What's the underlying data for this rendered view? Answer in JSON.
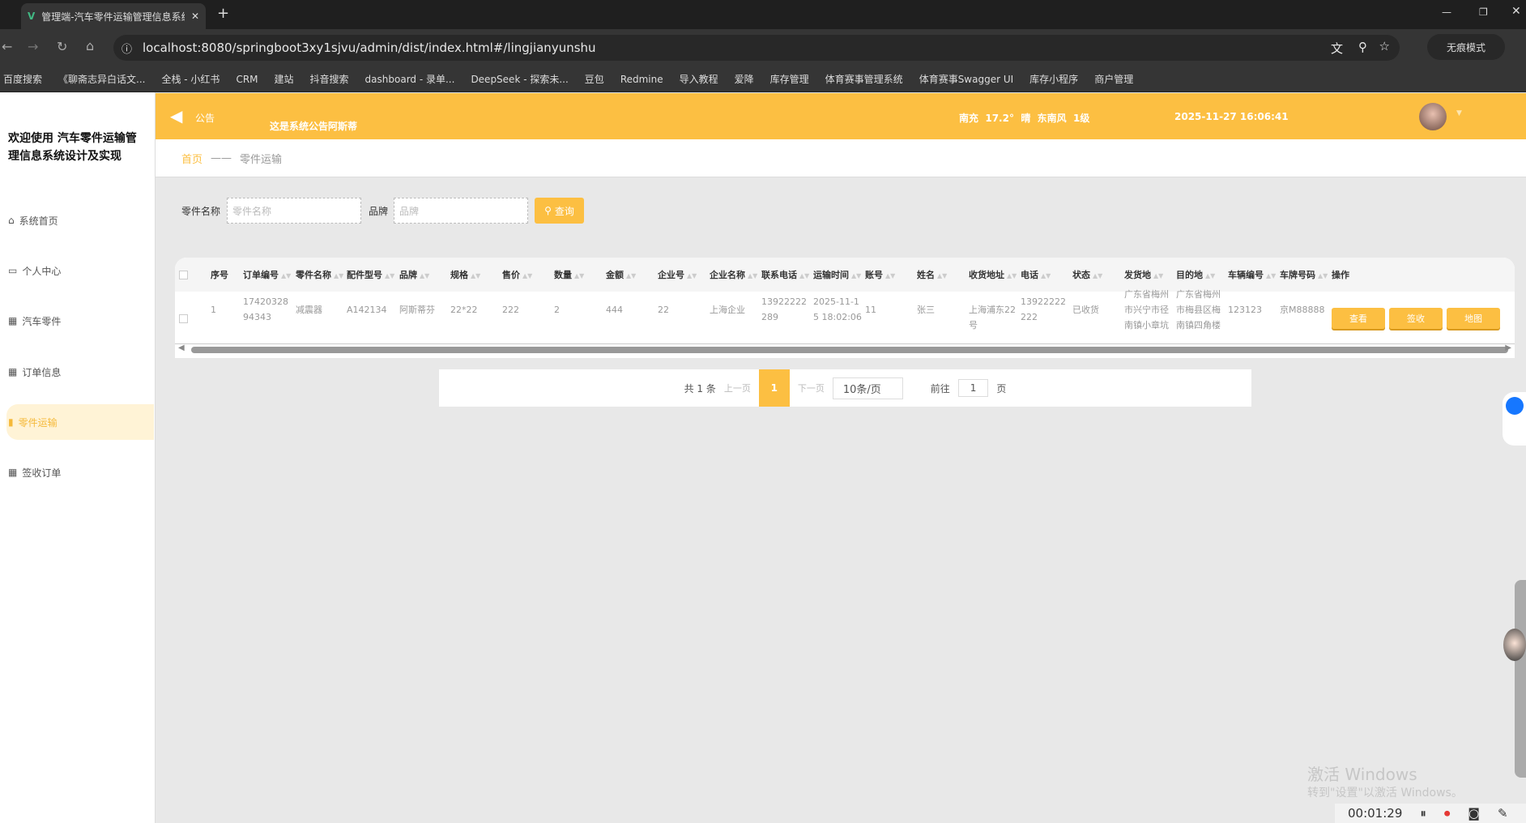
{
  "browser": {
    "tab_title": "管理端-汽车零件运输管理信息系统",
    "url": "localhost:8080/springboot3xy1sjvu/admin/dist/index.html#/lingjianyunshu",
    "incognito": "无痕模式",
    "bookmarks": [
      "百度搜索",
      "《聊斋志异白话文...",
      "全栈 - 小红书",
      "CRM",
      "建站",
      "抖音搜索",
      "dashboard - 录单...",
      "DeepSeek - 探索未...",
      "豆包",
      "Redmine",
      "导入教程",
      "爱降",
      "库存管理",
      "体育赛事管理系统",
      "体育赛事Swagger UI",
      "库存小程序",
      "商户管理"
    ]
  },
  "sidebar": {
    "welcome": "欢迎使用 汽车零件运输管理信息系统设计及实现",
    "items": [
      {
        "label": "系统首页",
        "icon": "home-icon"
      },
      {
        "label": "个人中心",
        "icon": "user-card-icon"
      },
      {
        "label": "汽车零件",
        "icon": "grid-icon"
      },
      {
        "label": "订单信息",
        "icon": "grid-icon"
      },
      {
        "label": "零件运输",
        "icon": "bar-chart-icon",
        "active": true
      },
      {
        "label": "签收订单",
        "icon": "grid-icon"
      }
    ]
  },
  "header": {
    "notice_label": "公告",
    "notice_text": "这是系统公告阿斯蒂",
    "weather": "南充  17.2°  晴  东南风  1级",
    "datetime": "2025-11-27 16:06:41"
  },
  "breadcrumb": {
    "home": "首页",
    "sep": "——",
    "current": "零件运输"
  },
  "search": {
    "name_label": "零件名称",
    "name_placeholder": "零件名称",
    "brand_label": "品牌",
    "brand_placeholder": "品牌",
    "query_button": "查询"
  },
  "table": {
    "headers": [
      "序号",
      "订单编号",
      "零件名称",
      "配件型号",
      "品牌",
      "规格",
      "售价",
      "数量",
      "金额",
      "企业号",
      "企业名称",
      "联系电话",
      "运输时间",
      "账号",
      "姓名",
      "收货地址",
      "电话",
      "状态",
      "发货地",
      "目的地",
      "车辆编号",
      "车牌号码",
      "操作"
    ],
    "rows": [
      [
        "1",
        "1742032894343",
        "减震器",
        "A142134",
        "阿斯蒂芬",
        "22*22",
        "222",
        "2",
        "444",
        "22",
        "上海企业",
        "13922222289",
        "2025-11-15 18:02:06",
        "11",
        "张三",
        "上海浦东22号",
        "13922222222",
        "已收货",
        "广东省梅州市兴宁市径南镇小章坑",
        "广东省梅州市梅县区梅南镇四角楼",
        "123123",
        "京M88888"
      ]
    ],
    "actions": [
      "查看",
      "签收",
      "地图"
    ]
  },
  "pagination": {
    "total": "共 1 条",
    "prev": "上一页",
    "page": "1",
    "next": "下一页",
    "page_size": "10条/页",
    "goto": "前往",
    "goto_value": "1",
    "page_unit": "页"
  },
  "watermark": {
    "line1": "激活 Windows",
    "line2": "转到\"设置\"以激活 Windows。"
  },
  "recorder": {
    "time": "00:01:29"
  },
  "colors": {
    "accent": "#fcbf42",
    "active_bg": "#fff3d6"
  }
}
